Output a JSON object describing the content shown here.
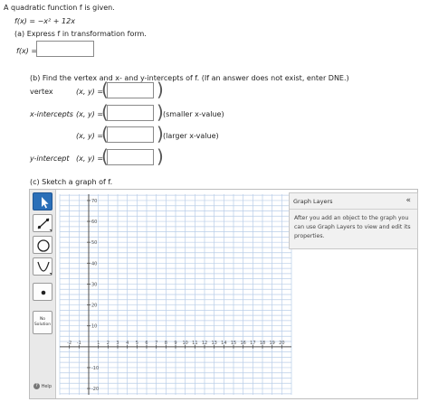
{
  "header": {
    "intro": "A quadratic function f is given.",
    "function_text": "f(x) = −x² + 12x"
  },
  "part_a": {
    "prompt": "(a) Express f in transformation form.",
    "label": "f(x) =",
    "value": ""
  },
  "part_b": {
    "prompt": "(b) Find the vertex and x- and y-intercepts of f. (If an answer does not exist, enter DNE.)",
    "rows": [
      {
        "label": "vertex",
        "coord": "(x, y) =",
        "value": "",
        "note": ""
      },
      {
        "label": "x-intercepts",
        "coord": "(x, y) =",
        "value": "",
        "note": "(smaller x-value)"
      },
      {
        "label": "",
        "coord": "(x, y) =",
        "value": "",
        "note": "(larger x-value)"
      },
      {
        "label": "y-intercept",
        "coord": "(x, y) =",
        "value": "",
        "note": ""
      }
    ]
  },
  "part_c": {
    "prompt": "(c) Sketch a graph of f."
  },
  "graph_tools": {
    "tools": [
      "pointer-icon",
      "line-icon",
      "circle-icon",
      "parabola-icon",
      "point-icon"
    ],
    "no_solution": [
      "No",
      "Solution"
    ],
    "help_label": "Help"
  },
  "axes": {
    "x_ticks": [
      "-2",
      "-1",
      "1",
      "2",
      "3",
      "4",
      "5",
      "6",
      "7",
      "8",
      "9",
      "10",
      "11",
      "12",
      "13",
      "14",
      "15",
      "16",
      "17",
      "18",
      "19",
      "20"
    ],
    "x_tick_values": [
      -2,
      -1,
      1,
      2,
      3,
      4,
      5,
      6,
      7,
      8,
      9,
      10,
      11,
      12,
      13,
      14,
      15,
      16,
      17,
      18,
      19,
      20
    ],
    "y_ticks": [
      "70",
      "60",
      "50",
      "40",
      "30",
      "20",
      "10",
      "-10",
      "-20"
    ],
    "y_tick_values": [
      70,
      60,
      50,
      40,
      30,
      20,
      10,
      -10,
      -20
    ],
    "x_range": [
      -3,
      21
    ],
    "y_range": [
      -23,
      73
    ],
    "grid_x_step": 1,
    "grid_y_step": 2.5
  },
  "graph_layers": {
    "title": "Graph Layers",
    "collapse": "«",
    "body": "After you add an object to the graph you can use Graph Layers to view and edit its properties."
  }
}
